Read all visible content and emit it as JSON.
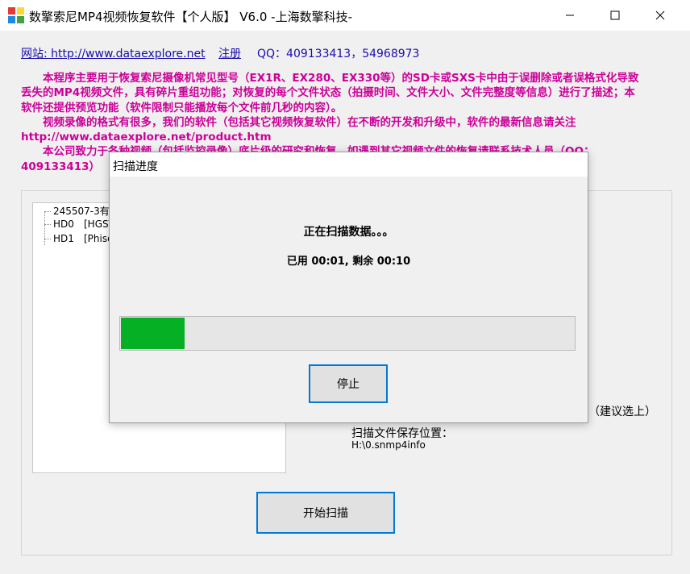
{
  "window": {
    "title": "数擎索尼MP4视频恢复软件【个人版】 V6.0  -上海数擎科技-",
    "icon": "app-icon",
    "controls": [
      "minimize-icon",
      "maximize-icon",
      "close-icon"
    ]
  },
  "header": {
    "website_link": "网站: http://www.dataexplore.net",
    "register_link": "注册",
    "qq": "QQ：409133413，54968973"
  },
  "description": {
    "paragraphs": [
      "　　本程序主要用于恢复索尼摄像机常见型号（EX1R、EX280、EX330等）的SD卡或SXS卡中由于误删除或者误格式化导致丢失的MP4视频文件，具有碎片重组功能；对恢复的每个文件状态（拍摄时间、文件大小、文件完整度等信息）进行了描述；本软件还提供预览功能（软件限制只能播放每个文件前几秒的内容）。",
      "　　视频录像的格式有很多，我们的软件（包括其它视频恢复软件）在不断的开发和升级中，软件的最新信息请关注 http://www.dataexplore.net/product.htm",
      "　　本公司致力于各种视频（包括监控录像）底片级的研究和恢复，如遇到其它视频文件的恢复请联系技术人员（QQ：409133413）"
    ],
    "color": "#cc0099"
  },
  "tree": {
    "root": "245507-3有",
    "items": [
      {
        "id": "HD0",
        "label": "[HGST"
      },
      {
        "id": "HD1",
        "label": "[Phiso"
      }
    ]
  },
  "hint_text": "（建议选上）",
  "save": {
    "label": "扫描文件保存位置：",
    "path": "H:\\0.snmp4info"
  },
  "start_button": "开始扫描",
  "dialog": {
    "title": "扫描进度",
    "status": "正在扫描数据。。。",
    "time": "已用 00:01, 剩余 00:10",
    "progress": 0.14,
    "progress_color": "#06b025",
    "stop_button": "停止"
  }
}
